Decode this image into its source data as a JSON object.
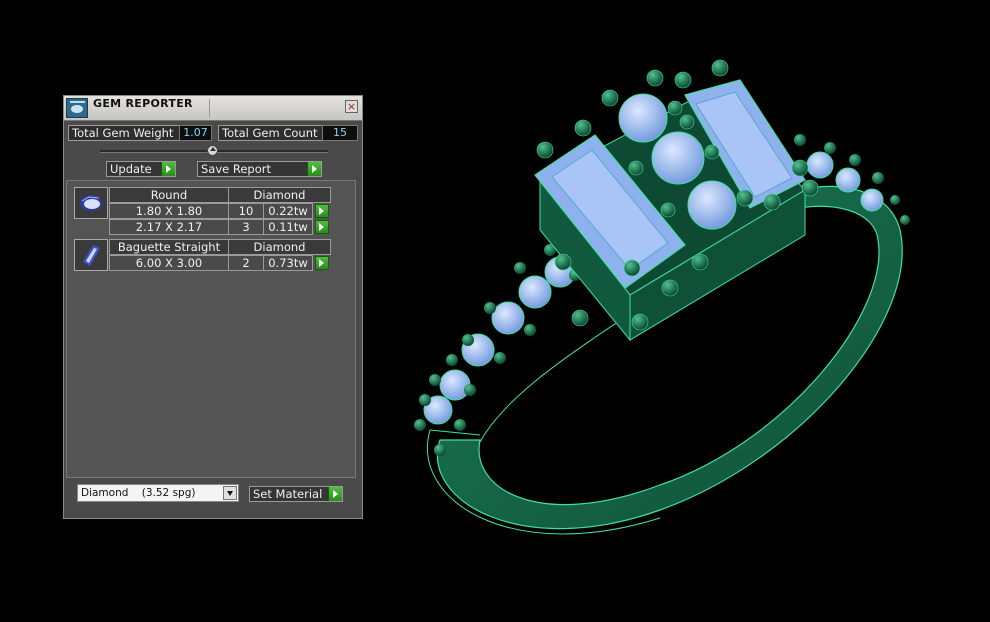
{
  "window": {
    "title": "GEM REPORTER",
    "close_glyph": "×"
  },
  "summary": {
    "total_weight_label": "Total Gem Weight",
    "total_weight_value": "1.07",
    "total_count_label": "Total Gem Count",
    "total_count_value": "15"
  },
  "actions": {
    "update_label": "Update",
    "save_report_label": "Save Report"
  },
  "gem_groups": [
    {
      "icon": "round-gem-icon",
      "shape": "Round",
      "material": "Diamond",
      "rows": [
        {
          "size": "1.80 X 1.80",
          "count": "10",
          "weight": "0.22tw"
        },
        {
          "size": "2.17 X 2.17",
          "count": "3",
          "weight": "0.11tw"
        }
      ]
    },
    {
      "icon": "baguette-gem-icon",
      "shape": "Baguette Straight",
      "material": "Diamond",
      "rows": [
        {
          "size": "6.00 X 3.00",
          "count": "2",
          "weight": "0.73tw"
        }
      ]
    }
  ],
  "material": {
    "selected": "Diamond    (3.52 spg)",
    "set_label": "Set Material"
  },
  "colors": {
    "metal": "#1f8a5e",
    "gem": "#7fa8e8",
    "panel": "#4a4a4a",
    "accent_green": "#3aa82a"
  }
}
